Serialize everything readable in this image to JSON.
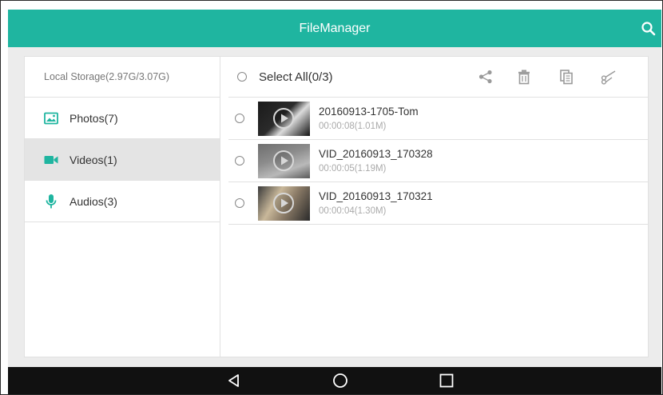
{
  "header": {
    "title": "FileManager"
  },
  "sidebar": {
    "storage": "Local Storage(2.97G/3.07G)",
    "items": [
      {
        "label": "Photos(7)",
        "icon": "image-icon",
        "active": false
      },
      {
        "label": "Videos(1)",
        "icon": "video-camera-icon",
        "active": true
      },
      {
        "label": "Audios(3)",
        "icon": "microphone-icon",
        "active": false
      }
    ]
  },
  "main": {
    "select_all": "Select All(0/3)",
    "tools": [
      "share-icon",
      "delete-icon",
      "copy-icon",
      "cut-icon"
    ],
    "files": [
      {
        "name": "20160913-1705-Tom",
        "meta": "00:00:08(1.01M)"
      },
      {
        "name": "VID_20160913_170328",
        "meta": "00:00:05(1.19M)"
      },
      {
        "name": "VID_20160913_170321",
        "meta": "00:00:04(1.30M)"
      }
    ]
  },
  "navbar": {
    "buttons": [
      "back-icon",
      "home-icon",
      "recents-icon"
    ]
  },
  "colors": {
    "accent": "#1fb5a0",
    "active_bg": "#e4e4e4",
    "navbar": "#111111"
  }
}
